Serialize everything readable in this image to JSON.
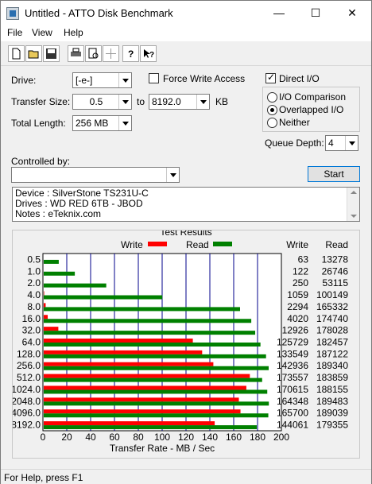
{
  "window": {
    "title": "Untitled - ATTO Disk Benchmark",
    "minimize": "—",
    "maximize": "☐",
    "close": "✕"
  },
  "menu": {
    "file": "File",
    "view": "View",
    "help": "Help"
  },
  "form": {
    "drive_label": "Drive:",
    "drive_value": "[-e-]",
    "transfer_size_label": "Transfer Size:",
    "transfer_from": "0.5",
    "transfer_to_label": "to",
    "transfer_to": "8192.0",
    "transfer_unit": "KB",
    "total_length_label": "Total Length:",
    "total_length": "256 MB",
    "force_write_label": "Force Write Access",
    "direct_io_label": "Direct I/O",
    "io_comparison_label": "I/O Comparison",
    "overlapped_io_label": "Overlapped I/O",
    "neither_label": "Neither",
    "queue_depth_label": "Queue Depth:",
    "queue_depth": "4",
    "controlled_by_label": "Controlled by:",
    "controlled_by_value": "",
    "start_label": "Start"
  },
  "notes": {
    "line1": "Device : SilverStone TS231U-C",
    "line2": "Drives : WD RED 6TB - JBOD",
    "line3": "Notes : eTeknix.com"
  },
  "results": {
    "title": "Test Results",
    "legend_write": "Write",
    "legend_read": "Read",
    "col_write": "Write",
    "col_read": "Read"
  },
  "colors": {
    "write": "#ff0000",
    "read": "#008000",
    "grid": "#00008b"
  },
  "chart_data": {
    "type": "bar",
    "categories": [
      "0.5",
      "1.0",
      "2.0",
      "4.0",
      "8.0",
      "16.0",
      "32.0",
      "64.0",
      "128.0",
      "256.0",
      "512.0",
      "1024.0",
      "2048.0",
      "4096.0",
      "8192.0"
    ],
    "series": [
      {
        "name": "Write",
        "values": [
          63,
          122,
          250,
          1059,
          2294,
          4020,
          12926,
          125729,
          133549,
          142936,
          173557,
          170615,
          164348,
          165700,
          144061
        ]
      },
      {
        "name": "Read",
        "values": [
          13278,
          26746,
          53115,
          100149,
          165332,
          174740,
          178028,
          182457,
          187122,
          189340,
          183859,
          188155,
          189483,
          189039,
          179355
        ]
      }
    ],
    "xlabel": "Transfer Rate - MB / Sec",
    "xlim": [
      0,
      200
    ],
    "xticks": [
      "0",
      "20",
      "40",
      "60",
      "80",
      "100",
      "120",
      "140",
      "160",
      "180",
      "200"
    ]
  },
  "status": {
    "text": "For Help, press F1"
  }
}
